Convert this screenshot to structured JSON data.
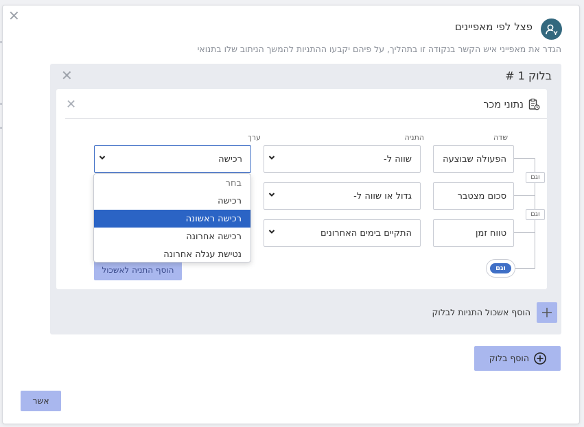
{
  "modal": {
    "title": "פצל לפי מאפיינים",
    "subtitle": "הגדר את מאפייני איש הקשר בנקודה זו בתהליך, על פיהם יקבעו ההתניות להמשך הניתוב שלו בתנואי",
    "close_icon": "close-icon",
    "header_icon": "user-split-icon",
    "accent_color": "#33687e"
  },
  "block": {
    "title": "בלוק 1 #",
    "group": {
      "title": "נתוני מכר",
      "icon": "clipboard-icon",
      "columns": {
        "field": "שדה",
        "condition": "התניה",
        "value": "ערך"
      },
      "rows": [
        {
          "field": "הפעולה שבוצעה",
          "condition": "שווה ל-",
          "value": "רכישה"
        },
        {
          "field": "סכום מצטבר",
          "condition": "גדול או שווה ל-"
        },
        {
          "field": "טווח זמן",
          "condition": "התקיים בימים האחרונים"
        }
      ],
      "and_label": "וגם",
      "and_toggle_label": "וגם",
      "add_condition_label": "הוסף התניה לאשכול",
      "value_dropdown": {
        "options": [
          "בחר",
          "רכישה",
          "רכישה ראשונה",
          "רכישה אחרונה",
          "נטישת עגלה אחרונה"
        ],
        "selected_index": 2,
        "highlight_color": "#2b64c5"
      }
    },
    "add_group_label": "הוסף אשכול התניות לבלוק"
  },
  "footer": {
    "add_block_label": "הוסף בלוק",
    "confirm_label": "אשר",
    "button_color": "#a9b7ee"
  }
}
